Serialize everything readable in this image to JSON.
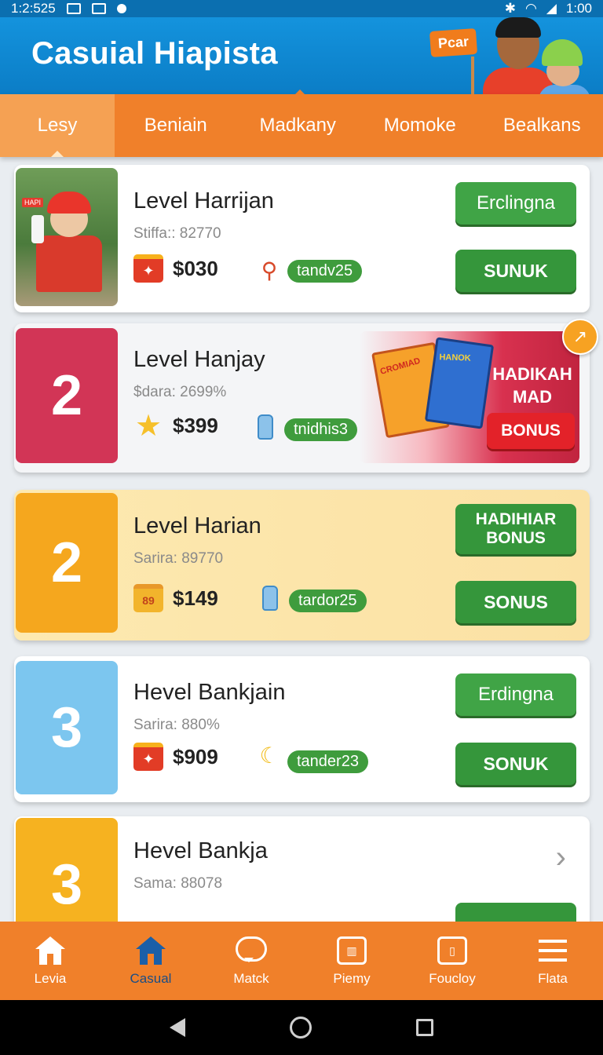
{
  "status_bar": {
    "time_left": "1:2:525",
    "time_right": "1:00"
  },
  "header": {
    "title": "Casuial Hiapista",
    "promo_sign": "Pcar"
  },
  "tabs": [
    {
      "label": "Lesy",
      "active": true
    },
    {
      "label": "Beniain",
      "active": false
    },
    {
      "label": "Madkany",
      "active": false
    },
    {
      "label": "Momoke",
      "active": false
    },
    {
      "label": "Bealkans",
      "active": false
    }
  ],
  "cards": [
    {
      "thumb_type": "photo",
      "photo_tag": "HAPI",
      "title": "Level Harrijan",
      "subtitle": "Stiffa:: 82770",
      "price": "$030",
      "prize_icon": "gift-icon",
      "item_icon": "broom-icon",
      "pill": "tandv25",
      "button1": "Erclingna",
      "button2": "SUNUK"
    },
    {
      "thumb_type": "number",
      "number": "2",
      "title": "Level Hanjay",
      "subtitle": "$dara: 2699%",
      "price": "$399",
      "prize_icon": "star-icon",
      "item_icon": "bottle-icon",
      "pill": "tnidhis3",
      "banner": {
        "bag1_text": "CROMIAD",
        "bag2_text": "HANOK",
        "title": "HADIKAH MAD",
        "button": "BONUS"
      },
      "corner_badge_icon": "trend-icon"
    },
    {
      "thumb_type": "number",
      "number": "2",
      "title": "Level Harian",
      "subtitle": "Sarira: 89770",
      "price": "$149",
      "prize_icon": "box-icon",
      "prize_text": "89",
      "item_icon": "bottle-icon",
      "pill": "tardor25",
      "button1": "HADIHIAR BONUS",
      "button2": "SONUS"
    },
    {
      "thumb_type": "number",
      "number": "3",
      "title": "Hevel Bankjain",
      "subtitle": "Sarira: 880%",
      "price": "$909",
      "prize_icon": "gift-icon",
      "item_icon": "banana-icon",
      "pill": "tander23",
      "button1": "Erdingna",
      "button2": "SONUK"
    },
    {
      "thumb_type": "number",
      "number": "3",
      "title": "Hevel Bankja",
      "subtitle": "Sama: 88078",
      "chevron_icon": "chevron-right-icon"
    }
  ],
  "bottom_nav": [
    {
      "label": "Levia",
      "icon": "home-icon",
      "active": false
    },
    {
      "label": "Casual",
      "icon": "home-icon",
      "active": true
    },
    {
      "label": "Matck",
      "icon": "chat-icon",
      "active": false
    },
    {
      "label": "Piemy",
      "icon": "grid-icon",
      "active": false
    },
    {
      "label": "Foucloy",
      "icon": "clipboard-icon",
      "active": false
    },
    {
      "label": "Flata",
      "icon": "menu-icon",
      "active": false
    }
  ],
  "colors": {
    "header_blue": "#0b7dc6",
    "tab_orange": "#f0802a",
    "button_green": "#40a446",
    "card_red": "#d23556",
    "card_orange": "#f5a71e",
    "card_blue": "#7cc6ef",
    "card_gold": "#f6b220",
    "bonus_red": "#e32229"
  }
}
